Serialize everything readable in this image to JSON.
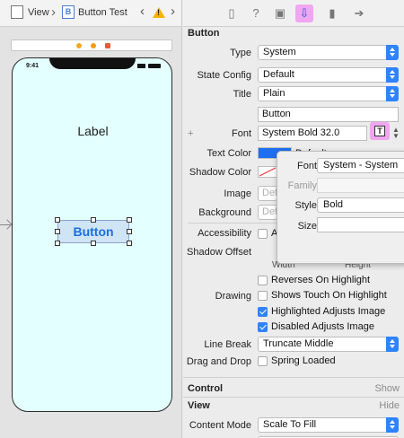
{
  "jumpbar": {
    "view_label": "View",
    "file_label": "Button Test",
    "file_icon_letter": "B"
  },
  "canvas": {
    "status_time": "9:41",
    "label_text": "Label",
    "button_text": "Button"
  },
  "inspector": {
    "tabs": [
      "file-icon",
      "help-icon",
      "identity-icon",
      "attributes-icon",
      "size-icon",
      "connections-icon"
    ],
    "active_tab": "attributes-icon",
    "button_section": {
      "title": "Button",
      "type_label": "Type",
      "type_value": "System",
      "state_config_label": "State Config",
      "state_config_value": "Default",
      "title_label": "Title",
      "title_value": "Plain",
      "title_text_value": "Button",
      "font_label": "Font",
      "font_value": "System Bold 32.0",
      "font_button_letter": "T",
      "text_color_label": "Text Color",
      "text_color_value": "Default",
      "shadow_color_label": "Shadow Color",
      "image_label": "Image",
      "image_placeholder": "Defa",
      "background_label": "Background",
      "background_placeholder": "Defa",
      "accessibility_label": "Accessibility",
      "accessibility_value": "Ac",
      "shadow_offset_label": "Shadow Offset",
      "width_label": "Width",
      "height_label": "Height",
      "reverses_label": "Reverses On Highlight",
      "reverses_checked": false,
      "drawing_label": "Drawing",
      "shows_touch_label": "Shows Touch On Highlight",
      "shows_touch_checked": false,
      "highlighted_adjusts_label": "Highlighted Adjusts Image",
      "highlighted_adjusts_checked": true,
      "disabled_adjusts_label": "Disabled Adjusts Image",
      "disabled_adjusts_checked": true,
      "line_break_label": "Line Break",
      "line_break_value": "Truncate Middle",
      "drag_drop_label": "Drag and Drop",
      "spring_loaded_label": "Spring Loaded",
      "spring_loaded_checked": false
    },
    "control_section": {
      "title": "Control",
      "action": "Show"
    },
    "view_section": {
      "title": "View",
      "action": "Hide",
      "content_mode_label": "Content Mode",
      "content_mode_value": "Scale To Fill"
    }
  },
  "font_popover": {
    "font_label": "Font",
    "font_value": "System - System",
    "family_label": "Family",
    "style_label": "Style",
    "style_value": "Bold",
    "size_label": "Size"
  },
  "colors": {
    "accent": "#2f83ff",
    "highlight": "#f0a6f0",
    "phone_bg": "#e3ffff",
    "button_text": "#1a6fe0",
    "text_color_swatch": "#1e6ff0",
    "warning": "#f5b400"
  }
}
